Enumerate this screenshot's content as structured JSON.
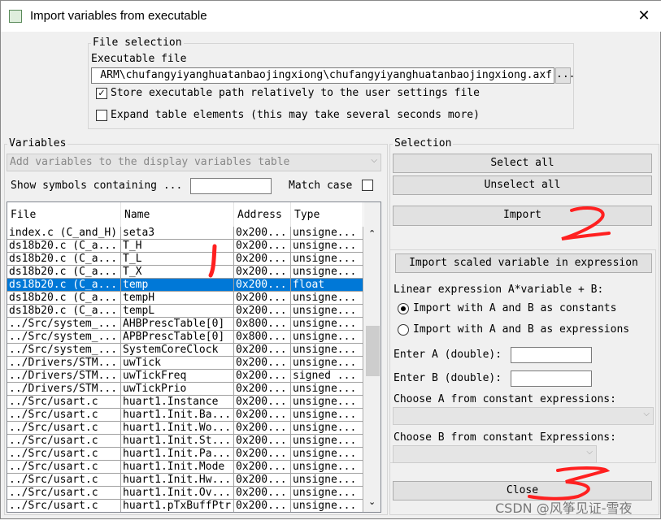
{
  "window": {
    "title": "Import variables from executable",
    "close": "✕"
  },
  "file_selection": {
    "legend": "File selection",
    "exe_label": "Executable file",
    "exe_path": "ARM\\chufangyiyanghuatanbaojingxiong\\chufangyiyanghuatanbaojingxiong.axf",
    "browse": "...",
    "store_relative": {
      "label": "Store executable path relatively to the user settings file",
      "checked": true
    },
    "expand_tables": {
      "label": "Expand table elements (this may take several seconds more)",
      "checked": false
    }
  },
  "variables": {
    "legend": "Variables",
    "add_combo": "Add variables to the display variables table",
    "show_label": "Show symbols containing ...",
    "filter_value": "",
    "match_case": "Match case",
    "columns": [
      "File",
      "Name",
      "Address",
      "Type"
    ],
    "rows": [
      [
        "index.c (C_and_H)",
        "seta3",
        "0x200...",
        "unsigne..."
      ],
      [
        "ds18b20.c (C_a...",
        "T_H",
        "0x200...",
        "unsigne..."
      ],
      [
        "ds18b20.c (C_a...",
        "T_L",
        "0x200...",
        "unsigne..."
      ],
      [
        "ds18b20.c (C_a...",
        "T_X",
        "0x200...",
        "unsigne..."
      ],
      [
        "ds18b20.c (C_a...",
        "temp",
        "0x200...",
        "float"
      ],
      [
        "ds18b20.c (C_a...",
        "tempH",
        "0x200...",
        "unsigne..."
      ],
      [
        "ds18b20.c (C_a...",
        "tempL",
        "0x200...",
        "unsigne..."
      ],
      [
        "../Src/system_...",
        "AHBPrescTable[0]",
        "0x800...",
        "unsigne..."
      ],
      [
        "../Src/system_...",
        "APBPrescTable[0]",
        "0x800...",
        "unsigne..."
      ],
      [
        "../Src/system_...",
        "SystemCoreClock",
        "0x200...",
        "unsigne..."
      ],
      [
        "../Drivers/STM...",
        "uwTick",
        "0x200...",
        "unsigne..."
      ],
      [
        "../Drivers/STM...",
        "uwTickFreq",
        "0x200...",
        "signed ..."
      ],
      [
        "../Drivers/STM...",
        "uwTickPrio",
        "0x200...",
        "unsigne..."
      ],
      [
        "../Src/usart.c",
        "huart1.Instance",
        "0x200...",
        "unsigne..."
      ],
      [
        "../Src/usart.c",
        "huart1.Init.Ba...",
        "0x200...",
        "unsigne..."
      ],
      [
        "../Src/usart.c",
        "huart1.Init.Wo...",
        "0x200...",
        "unsigne..."
      ],
      [
        "../Src/usart.c",
        "huart1.Init.St...",
        "0x200...",
        "unsigne..."
      ],
      [
        "../Src/usart.c",
        "huart1.Init.Pa...",
        "0x200...",
        "unsigne..."
      ],
      [
        "../Src/usart.c",
        "huart1.Init.Mode",
        "0x200...",
        "unsigne..."
      ],
      [
        "../Src/usart.c",
        "huart1.Init.Hw...",
        "0x200...",
        "unsigne..."
      ],
      [
        "../Src/usart.c",
        "huart1.Init.Ov...",
        "0x200...",
        "unsigne..."
      ],
      [
        "../Src/usart.c",
        "huart1.pTxBuffPtr",
        "0x200...",
        "unsigne..."
      ]
    ],
    "selected_row": 4
  },
  "selection": {
    "legend": "Selection",
    "select_all": "Select all",
    "unselect_all": "Unselect all",
    "import": "Import",
    "import_scaled": "Import scaled variable in expression",
    "linear_label": "Linear expression A*variable + B:",
    "radio_constants": "Import with A and B as constants",
    "radio_expressions": "Import with A and B as expressions",
    "radio_selected": "constants",
    "enter_a": "Enter A (double):",
    "enter_b": "Enter B (double):",
    "a_value": "",
    "b_value": "",
    "choose_a": "Choose A from constant expressions:",
    "choose_b": "Choose B from constant Expressions:",
    "close": "Close"
  },
  "annotations": {
    "marks": [
      "1",
      "2",
      "3"
    ],
    "color": "#ff2020"
  },
  "watermark": "CSDN @风筝见证-雪夜"
}
